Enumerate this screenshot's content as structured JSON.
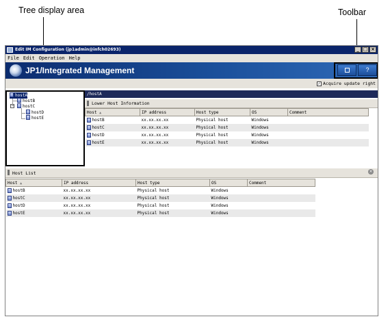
{
  "callouts": {
    "tree_display": "Tree display area",
    "toolbar": "Toolbar"
  },
  "window": {
    "title": "Edit IM Configuration (jp1admin@infch02693)",
    "controls": {
      "minimize": "_",
      "maximize": "□",
      "close": "×"
    }
  },
  "menu": [
    "File",
    "Edit",
    "Operation",
    "Help"
  ],
  "header": {
    "app_name": "JP1/Integrated Management",
    "toolbar_buttons": [
      {
        "icon": "window-icon",
        "label": ""
      },
      {
        "icon": "help-icon",
        "label": "?"
      }
    ]
  },
  "options": {
    "acquire_update_right_label": "Acquire update right",
    "acquire_update_right_checked": true
  },
  "tree": {
    "items": [
      {
        "label": "hostA",
        "level": 0,
        "selected": true
      },
      {
        "label": "hostB",
        "level": 1
      },
      {
        "label": "hostC",
        "level": 1,
        "expanded": true
      },
      {
        "label": "hostD",
        "level": 2
      },
      {
        "label": "hostE",
        "level": 2
      }
    ]
  },
  "path": "/hostA",
  "lower_host_info": {
    "title": "Lower Host Information",
    "columns": [
      "Host",
      "IP address",
      "Host type",
      "OS",
      "Comment"
    ],
    "rows": [
      {
        "host": "hostB",
        "ip": "xx.xx.xx.xx",
        "type": "Physical host",
        "os": "Windows",
        "comment": ""
      },
      {
        "host": "hostC",
        "ip": "xx.xx.xx.xx",
        "type": "Physical host",
        "os": "Windows",
        "comment": ""
      },
      {
        "host": "hostD",
        "ip": "xx.xx.xx.xx",
        "type": "Physical host",
        "os": "Windows",
        "comment": ""
      },
      {
        "host": "hostE",
        "ip": "xx.xx.xx.xx",
        "type": "Physical host",
        "os": "Windows",
        "comment": ""
      }
    ]
  },
  "host_list": {
    "title": "Host List",
    "columns": [
      "Host",
      "IP address",
      "Host type",
      "OS",
      "Comment"
    ],
    "rows": [
      {
        "host": "hostB",
        "ip": "xx.xx.xx.xx",
        "type": "Physical host",
        "os": "Windows",
        "comment": ""
      },
      {
        "host": "hostC",
        "ip": "xx.xx.xx.xx",
        "type": "Physical host",
        "os": "Windows",
        "comment": ""
      },
      {
        "host": "hostD",
        "ip": "xx.xx.xx.xx",
        "type": "Physical host",
        "os": "Windows",
        "comment": ""
      },
      {
        "host": "hostE",
        "ip": "xx.xx.xx.xx",
        "type": "Physical host",
        "os": "Windows",
        "comment": ""
      }
    ]
  }
}
